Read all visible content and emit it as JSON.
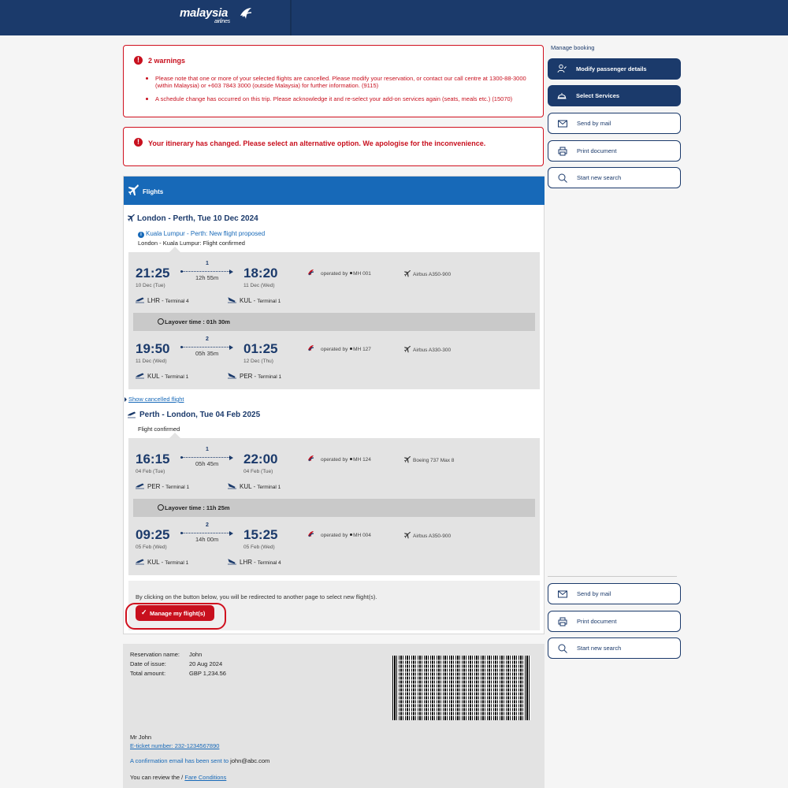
{
  "header": {
    "brand": "malaysia",
    "brand_sub": "airlines"
  },
  "warnings": {
    "title": "2 warnings",
    "items": [
      "Please note that one or more of your selected flights are cancelled. Please modify your reservation, or contact our call centre at 1300-88-3000 (within Malaysia) or +603 7843 3000 (outside Malaysia) for further information. (9115)",
      "A schedule change has occurred on this trip. Please acknowledge it and re-select your add-on services again (seats, meals etc.) (15070)"
    ]
  },
  "itinerary_change": "Your itinerary has changed. Please select an alternative option. We apologise for the inconvenience.",
  "flights": {
    "header": "Flights",
    "outbound": {
      "title": "London - Perth, Tue 10 Dec 2024",
      "info": "Kuala Lumpur - Perth: New flight proposed",
      "status": "London - Kuala Lumpur: Flight confirmed",
      "leg1": {
        "dep_time": "21:25",
        "dep_date": "10 Dec (Tue)",
        "arr_time": "18:20",
        "arr_date": "11 Dec (Wed)",
        "stops": "1",
        "duration": "12h 55m",
        "dep_airport": "LHR",
        "dep_terminal": "Terminal 4",
        "arr_airport": "KUL",
        "arr_terminal": "Terminal 1",
        "operated": "operated by",
        "flight_no": "MH 001",
        "aircraft": "Airbus A350-900"
      },
      "layover": "Layover time : 01h 30m",
      "leg2": {
        "dep_time": "19:50",
        "dep_date": "11 Dec (Wed)",
        "arr_time": "01:25",
        "arr_date": "12 Dec (Thu)",
        "stops": "2",
        "duration": "05h 35m",
        "dep_airport": "KUL",
        "dep_terminal": "Terminal 1",
        "arr_airport": "PER",
        "arr_terminal": "Terminal 1",
        "operated": "operated by",
        "flight_no": "MH 127",
        "aircraft": "Airbus A330-300"
      }
    },
    "show_cancelled": "Show cancelled flight",
    "inbound": {
      "title": "Perth - London, Tue 04 Feb 2025",
      "status": "Flight confirmed",
      "leg1": {
        "dep_time": "16:15",
        "dep_date": "04 Feb (Tue)",
        "arr_time": "22:00",
        "arr_date": "04 Feb (Tue)",
        "stops": "1",
        "duration": "05h 45m",
        "dep_airport": "PER",
        "dep_terminal": "Terminal 1",
        "arr_airport": "KUL",
        "arr_terminal": "Terminal 1",
        "operated": "operated by",
        "flight_no": "MH 124",
        "aircraft": "Boeing 737 Max 8"
      },
      "layover": "Layover time : 11h 25m",
      "leg2": {
        "dep_time": "09:25",
        "dep_date": "05 Feb (Wed)",
        "arr_time": "15:25",
        "arr_date": "05 Feb (Wed)",
        "stops": "2",
        "duration": "14h 00m",
        "dep_airport": "KUL",
        "dep_terminal": "Terminal 1",
        "arr_airport": "LHR",
        "arr_terminal": "Terminal 4",
        "operated": "operated by",
        "flight_no": "MH 004",
        "aircraft": "Airbus A350-900"
      }
    },
    "redirect_text": "By clicking on the button below, you will be redirected to another page to select new flight(s).",
    "manage_button": "Manage my flight(s)"
  },
  "summary": {
    "reservation_label": "Reservation name:",
    "reservation_value": "John",
    "issue_label": "Date of issue:",
    "issue_value": "20 Aug 2024",
    "total_label": "Total amount:",
    "total_value": "GBP 1,234.56",
    "passenger": "Mr John",
    "eticket_label": "E-ticket number:",
    "eticket_value": "232-1234567890",
    "email_text": "A confirmation email has been sent to",
    "email_value": "john@abc.com",
    "review_text": "You can review the /",
    "fare_link": "Fare Conditions"
  },
  "sidebar": {
    "heading": "Manage booking",
    "modify": "Modify passenger details",
    "services": "Select Services",
    "send_mail": "Send by mail",
    "print": "Print document",
    "new_search": "Start new search"
  },
  "colors": {
    "navy": "#1b3a6b",
    "blue": "#1769b8",
    "red": "#c8101e"
  }
}
